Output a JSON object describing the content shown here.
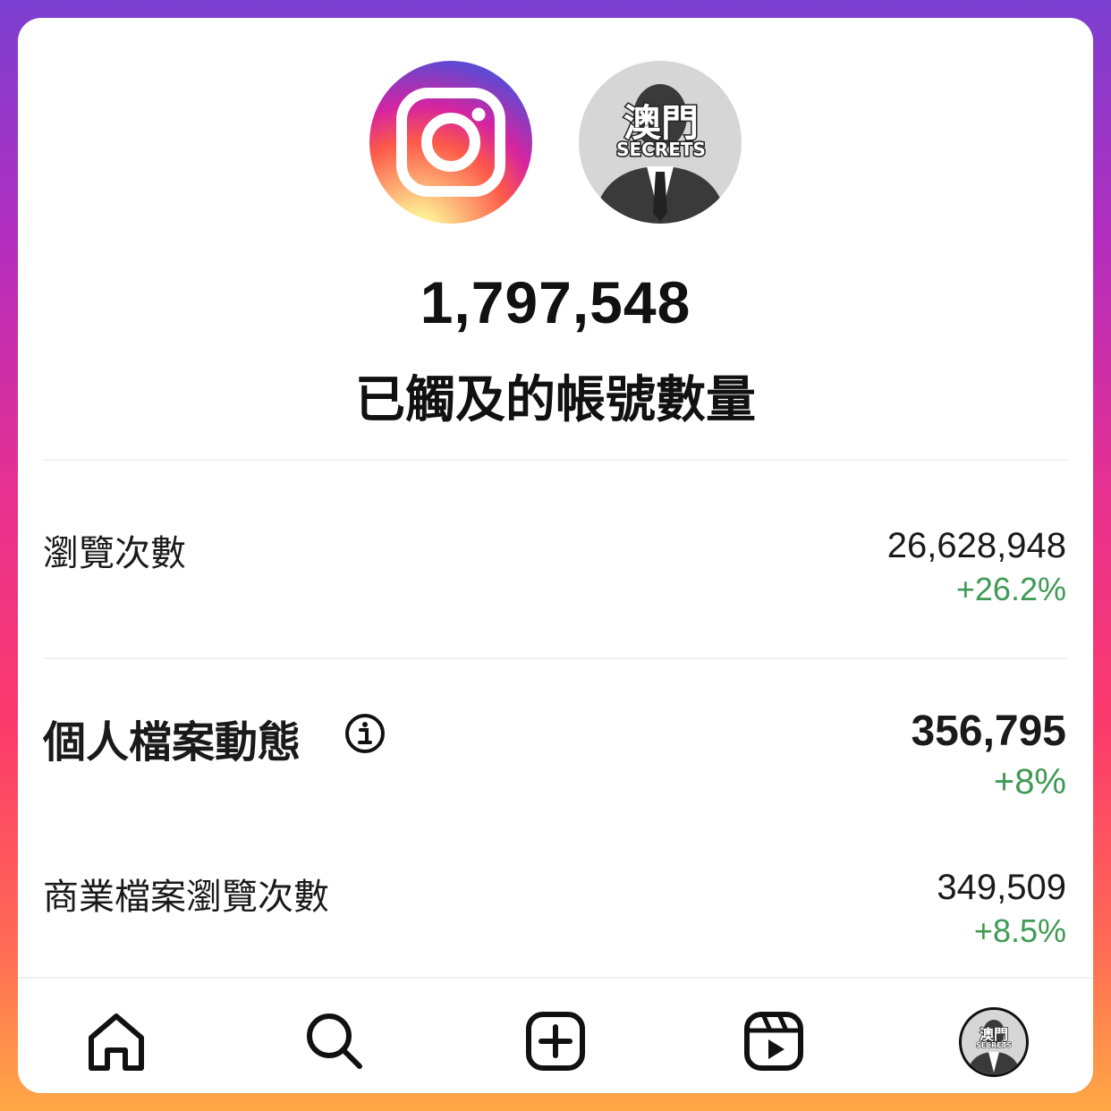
{
  "logos": {
    "app_icon": "instagram-logo",
    "account_avatar_text_main": "澳門",
    "account_avatar_text_sub": "SECRETS"
  },
  "hero": {
    "value": "1,797,548",
    "label": "已觸及的帳號數量"
  },
  "stats": [
    {
      "label": "瀏覽次數",
      "value": "26,628,948",
      "change": "+26.2%"
    },
    {
      "label": "個人檔案動態",
      "value": "356,795",
      "change": "+8%",
      "info_icon": "info-icon"
    },
    {
      "label": "商業檔案瀏覽次數",
      "value": "349,509",
      "change": "+8.5%"
    }
  ],
  "colors": {
    "positive": "#3f9a55",
    "text": "#1a1a1a"
  },
  "nav": {
    "items": [
      "home-icon",
      "search-icon",
      "create-post-icon",
      "reels-icon",
      "profile-avatar"
    ]
  }
}
